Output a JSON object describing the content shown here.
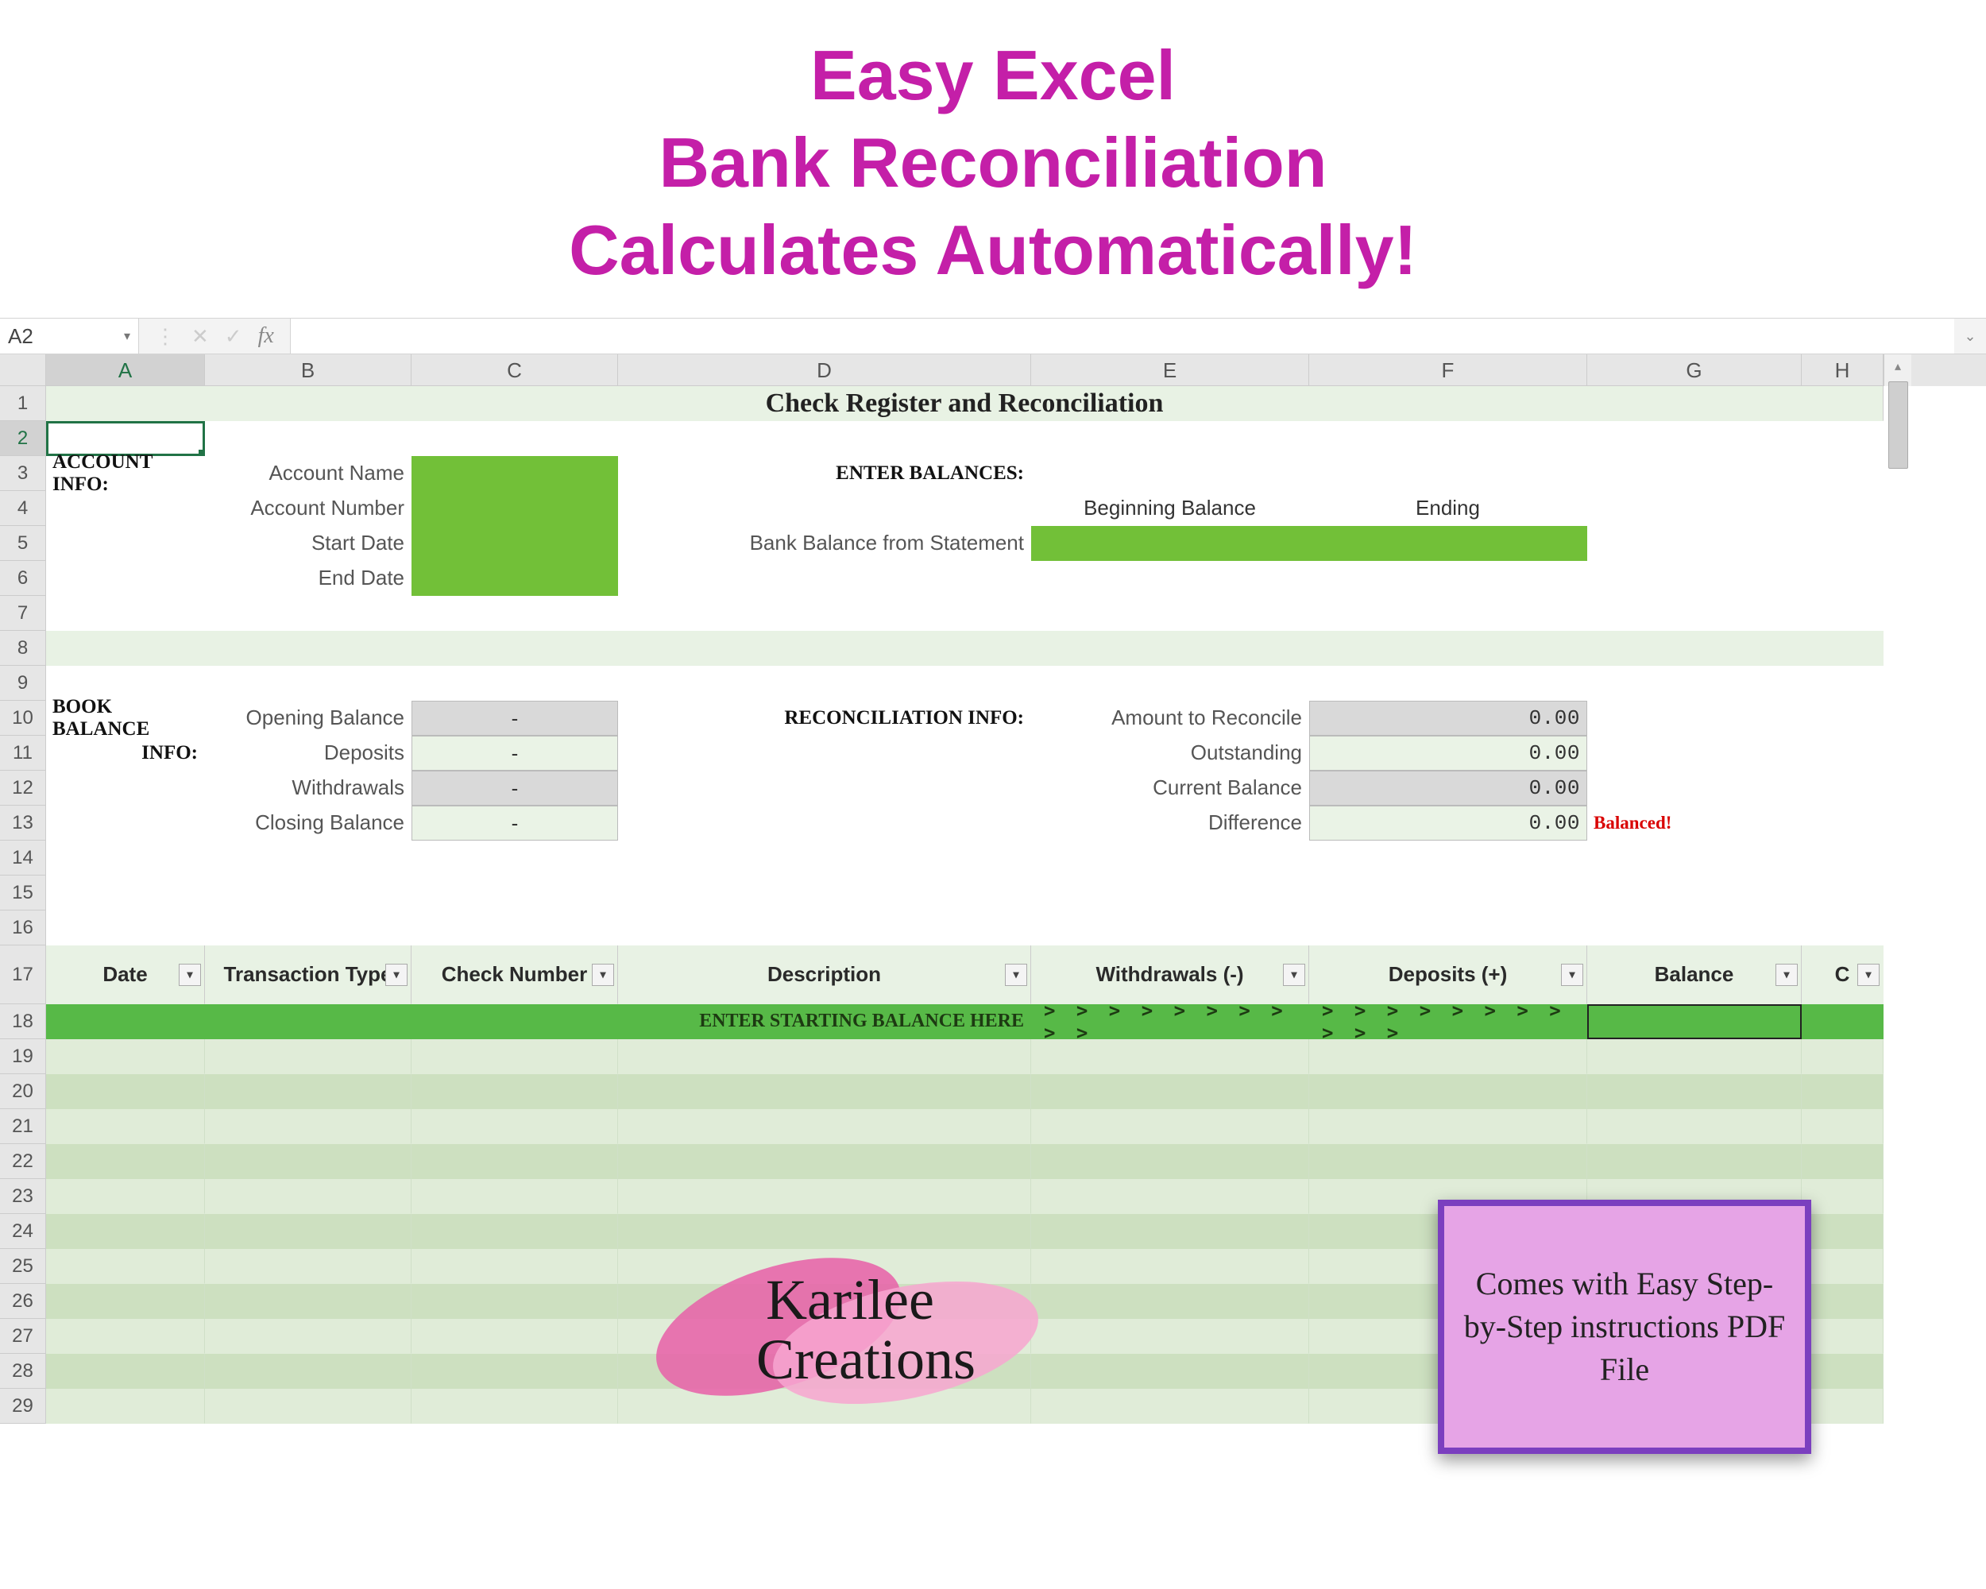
{
  "banner": {
    "line1": "Easy Excel",
    "line2": "Bank Reconciliation",
    "line3": "Calculates Automatically!"
  },
  "formula_bar": {
    "name_box": "A2",
    "fx_label": "fx",
    "formula": ""
  },
  "columns": [
    "A",
    "B",
    "C",
    "D",
    "E",
    "F",
    "G",
    "H"
  ],
  "row_count": 29,
  "selected_cell": "A2",
  "sheet": {
    "title": "Check Register and Reconciliation",
    "account_info_label": "ACCOUNT INFO:",
    "account_fields": [
      "Account Name",
      "Account Number",
      "Start Date",
      "End Date"
    ],
    "enter_balances_label": "ENTER BALANCES:",
    "balance_cols": [
      "Beginning Balance",
      "Ending"
    ],
    "bank_balance_label": "Bank Balance from Statement",
    "book_balance_label1": "BOOK BALANCE",
    "book_balance_label2": "INFO:",
    "book_fields": [
      {
        "label": "Opening Balance",
        "value": "-"
      },
      {
        "label": "Deposits",
        "value": "-"
      },
      {
        "label": "Withdrawals",
        "value": "-"
      },
      {
        "label": "Closing Balance",
        "value": "-"
      }
    ],
    "recon_label": "RECONCILIATION INFO:",
    "recon_fields": [
      {
        "label": "Amount to Reconcile",
        "value": "0.00"
      },
      {
        "label": "Outstanding",
        "value": "0.00"
      },
      {
        "label": "Current Balance",
        "value": "0.00"
      },
      {
        "label": "Difference",
        "value": "0.00"
      }
    ],
    "balanced_flag": "Balanced!",
    "table_headers": [
      "Date",
      "Transaction Type",
      "Check Number",
      "Description",
      "Withdrawals (-)",
      "Deposits (+)",
      "Balance",
      "C"
    ],
    "starting_balance_text": "ENTER STARTING BALANCE HERE",
    "arrows_left": ">  >  >  >  >  >  >  >  >  >",
    "arrows_right": ">  >  >  >  >  >  >  >  >  >  >"
  },
  "callout": {
    "text": "Comes with Easy Step-by-Step instructions PDF File"
  },
  "logo_text": "Karilee Creations"
}
